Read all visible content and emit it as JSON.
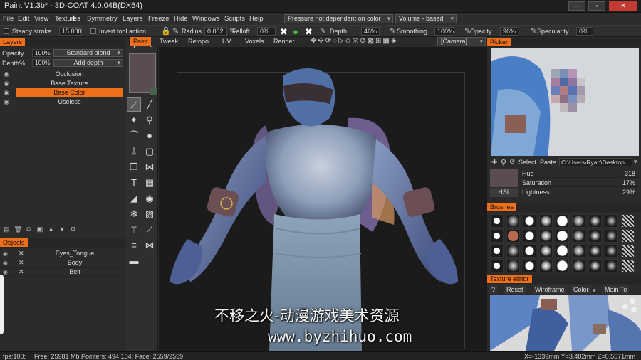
{
  "window": {
    "title": "Paint V1.3b* - 3D-COAT 4.0.04B(DX64)",
    "min_label": "—",
    "max_label": "▫",
    "close_label": "✕"
  },
  "menu": {
    "items": [
      "File",
      "Edit",
      "View",
      "Textures",
      "Symmetry",
      "Layers",
      "Freeze",
      "Hide",
      "Windows",
      "Scripts",
      "Help"
    ],
    "pressure_dropdown": "Pressure not dependent on color",
    "volume_dropdown": "Volume - based"
  },
  "toolbar": {
    "steady_stroke_label": "Steady stroke",
    "steady_stroke_value": "15.000",
    "invert_tool_label": "Invert tool action",
    "radius_label": "Radius",
    "radius_value": "0.082",
    "falloff_label": "Falloff",
    "falloff_value": "0%",
    "depth_label": "Depth",
    "depth_value": "46%",
    "smoothing_label": "Smoothing",
    "smoothing_value": "100%",
    "opacity_label": "Opacity",
    "opacity_value": "96%",
    "specularity_label": "Specularity",
    "specularity_value": "0%"
  },
  "layers_panel": {
    "header": "Layers",
    "opacity_label": "Opacity",
    "opacity_value": "100%",
    "blend_mode": "Standard blend",
    "depth_label": "Depth%",
    "depth_value": "100%",
    "depth_mode": "Add depth",
    "layers": [
      {
        "name": "Occlusion",
        "selected": false
      },
      {
        "name": "Base Texture",
        "selected": false
      },
      {
        "name": "Base Color",
        "selected": true
      },
      {
        "name": "Useless",
        "selected": false
      }
    ]
  },
  "objects_panel": {
    "header": "Objects",
    "objects": [
      "Eyes_Tongue",
      "Body",
      "Belt"
    ]
  },
  "viewport": {
    "tabs": [
      "Paint",
      "Tweak",
      "Retopo",
      "UV",
      "Voxels",
      "Render"
    ],
    "active_tab": "Paint",
    "camera_dropdown": "[Camera]"
  },
  "picker_panel": {
    "header": "Picker",
    "select_label": "Select",
    "paste_label": "Paste",
    "path": "C:\\Users\\Ryan\\Desktop",
    "mode_label": "HSL",
    "hue_label": "Hue",
    "hue_value": "318",
    "saturation_label": "Saturation",
    "saturation_value": "17%",
    "lightness_label": "Lightness",
    "lightness_value": "29%",
    "swatch_color": "#5a4c51"
  },
  "brushes_panel": {
    "header": "Brushes"
  },
  "texture_panel": {
    "header": "Texture editor",
    "help": "?",
    "reset_label": "Reset",
    "wireframe_label": "Wireframe",
    "color_label": "Color",
    "main_label": "Main Te"
  },
  "status": {
    "fps": "fps:100;",
    "memory": "Free: 25981 Mb,Pointers: 494  104; Face: 2559/2559",
    "coords": "X=-1339mm  Y=3.482mm  Z=0.5571mm"
  },
  "watermark": {
    "line1": "不移之火-动漫游戏美术资源",
    "line2": "www.byzhihuo.com"
  },
  "colors": {
    "accent": "#ee6f1a",
    "panel_bg": "#2b2b2b",
    "viewport_bg": "#1b1b1b"
  }
}
